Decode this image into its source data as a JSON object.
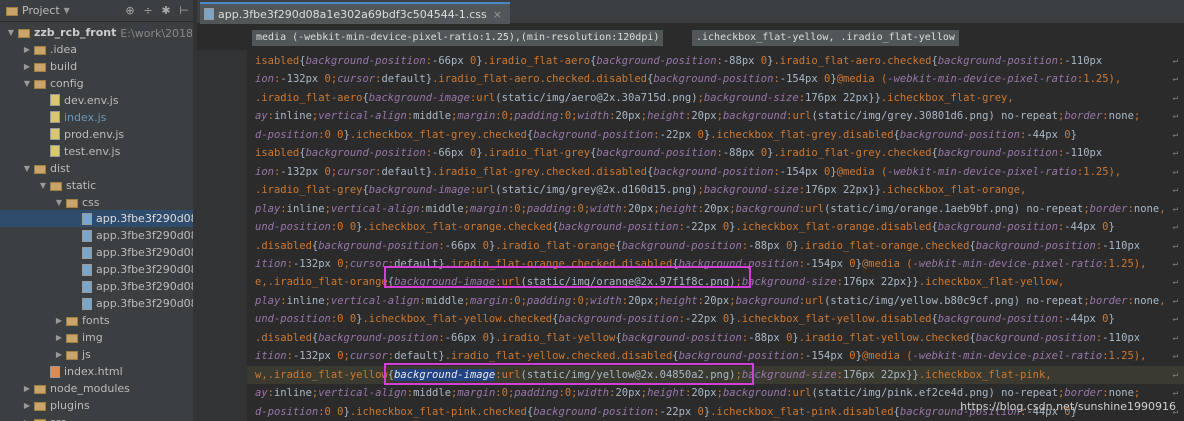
{
  "project": {
    "title": "Project",
    "toolbar_icons": [
      "settings-icon",
      "target-icon",
      "gear-icon",
      "collapse-icon"
    ]
  },
  "tree": [
    {
      "label": "zzb_rcb_front",
      "hint": "E:\\work\\2018\\9月\\",
      "type": "folder",
      "open": true,
      "indent": 0
    },
    {
      "label": ".idea",
      "type": "folder",
      "open": false,
      "indent": 1
    },
    {
      "label": "build",
      "type": "folder",
      "open": false,
      "indent": 1
    },
    {
      "label": "config",
      "type": "folder",
      "open": true,
      "indent": 1
    },
    {
      "label": "dev.env.js",
      "type": "js",
      "indent": 2
    },
    {
      "label": "index.js",
      "type": "js",
      "indent": 2
    },
    {
      "label": "prod.env.js",
      "type": "js",
      "indent": 2
    },
    {
      "label": "test.env.js",
      "type": "js",
      "indent": 2
    },
    {
      "label": "dist",
      "type": "folder",
      "open": true,
      "indent": 1
    },
    {
      "label": "static",
      "type": "folder",
      "open": true,
      "indent": 2
    },
    {
      "label": "css",
      "type": "folder",
      "open": true,
      "indent": 3
    },
    {
      "label": "app.3fbe3f290d08a1e",
      "type": "css",
      "indent": 4,
      "selected": true
    },
    {
      "label": "app.3fbe3f290d08a1e",
      "type": "css",
      "indent": 4
    },
    {
      "label": "app.3fbe3f290d08a1e",
      "type": "css",
      "indent": 4
    },
    {
      "label": "app.3fbe3f290d08a1e",
      "type": "css",
      "indent": 4
    },
    {
      "label": "app.3fbe3f290d08a1e",
      "type": "css",
      "indent": 4
    },
    {
      "label": "app.3fbe3f290d08a1e",
      "type": "css",
      "indent": 4
    },
    {
      "label": "fonts",
      "type": "folder",
      "open": false,
      "indent": 3
    },
    {
      "label": "img",
      "type": "folder",
      "open": false,
      "indent": 3
    },
    {
      "label": "js",
      "type": "folder",
      "open": false,
      "indent": 3
    },
    {
      "label": "index.html",
      "type": "html",
      "indent": 2
    },
    {
      "label": "node_modules",
      "type": "folder",
      "open": false,
      "indent": 1
    },
    {
      "label": "plugins",
      "type": "folder",
      "open": false,
      "indent": 1
    },
    {
      "label": "src",
      "type": "folder",
      "open": false,
      "indent": 1
    }
  ],
  "tab": {
    "label": "app.3fbe3f290d08a1e302a69bdf3c504544-1.css",
    "close": "×"
  },
  "breadcrumbs": [
    "media (-webkit-min-device-pixel-ratio:1.25),(min-resolution:120dpi)",
    ".icheckbox_flat-yellow, .iradio_flat-yellow"
  ],
  "code_lines": [
    "isabled{background-position:-66px 0}.iradio_flat-aero{background-position:-88px 0}.iradio_flat-aero.checked{background-position:-110px",
    "ion:-132px 0;cursor:default}.iradio_flat-aero.checked.disabled{background-position:-154px 0}@media (-webkit-min-device-pixel-ratio:1.25),",
    ".iradio_flat-aero{background-image:url(static/img/aero@2x.30a715d.png);background-size:176px 22px}}.icheckbox_flat-grey,",
    "ay:inline;vertical-align:middle;margin:0;padding:0;width:20px;height:20px;background:url(static/img/grey.30801d6.png) no-repeat;border:none;",
    "d-position:0 0}.icheckbox_flat-grey.checked{background-position:-22px 0}.icheckbox_flat-grey.disabled{background-position:-44px 0}",
    "isabled{background-position:-66px 0}.iradio_flat-grey{background-position:-88px 0}.iradio_flat-grey.checked{background-position:-110px",
    "ion:-132px 0;cursor:default}.iradio_flat-grey.checked.disabled{background-position:-154px 0}@media (-webkit-min-device-pixel-ratio:1.25),",
    ".iradio_flat-grey{background-image:url(static/img/grey@2x.d160d15.png);background-size:176px 22px}}.icheckbox_flat-orange,",
    "play:inline;vertical-align:middle;margin:0;padding:0;width:20px;height:20px;background:url(static/img/orange.1aeb9bf.png) no-repeat;border:none,",
    "und-position:0 0}.icheckbox_flat-orange.checked{background-position:-22px 0}.icheckbox_flat-orange.disabled{background-position:-44px 0}",
    ".disabled{background-position:-66px 0}.iradio_flat-orange{background-position:-88px 0}.iradio_flat-orange.checked{background-position:-110px",
    "ition:-132px 0;cursor:default}.iradio_flat-orange.checked.disabled{background-position:-154px 0}@media (-webkit-min-device-pixel-ratio:1.25),",
    "e,.iradio_flat-orange{background-image:url(static/img/orange@2x.97f1f8c.png);background-size:176px 22px}}.icheckbox_flat-yellow,",
    "play:inline;vertical-align:middle;margin:0;padding:0;width:20px;height:20px;background:url(static/img/yellow.b80c9cf.png) no-repeat;border:none,",
    "und-position:0 0}.icheckbox_flat-yellow.checked{background-position:-22px 0}.icheckbox_flat-yellow.disabled{background-position:-44px 0}",
    ".disabled{background-position:-66px 0}.iradio_flat-yellow{background-position:-88px 0}.iradio_flat-yellow.checked{background-position:-110px",
    "ition:-132px 0;cursor:default}.iradio_flat-yellow.checked.disabled{background-position:-154px 0}@media (-webkit-min-device-pixel-ratio:1.25),",
    "w,.iradio_flat-yellow{background-image:url(static/img/yellow@2x.04850a2.png);background-size:176px 22px}}.icheckbox_flat-pink,",
    "ay:inline;vertical-align:middle;margin:0;padding:0;width:20px;height:20px;background:url(static/img/pink.ef2ce4d.png) no-repeat;border:none;",
    "d-position:0 0}.icheckbox_flat-pink.checked{background-position:-22px 0}.icheckbox_flat-pink.disabled{background-position:-44px 0}"
  ],
  "current_line_index": 17,
  "selected_text": "background-image",
  "watermark": "https://blog.csdn.net/sunshine1990916",
  "colors": {
    "highlight_box": "#d23fd6",
    "selection": "#214283",
    "keyword": "#cc7832"
  }
}
